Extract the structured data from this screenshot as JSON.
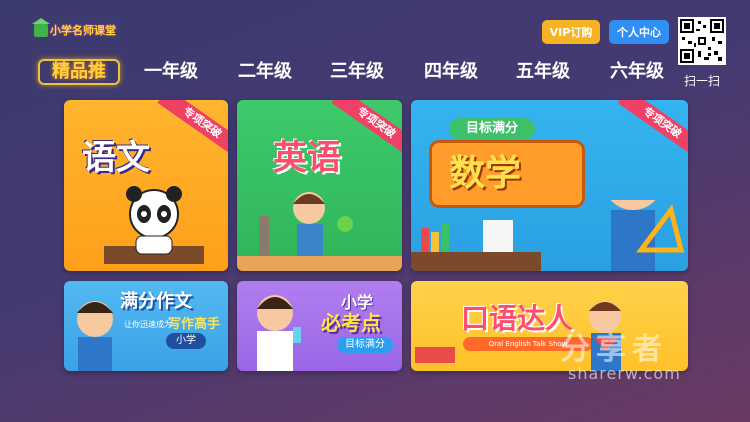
{
  "header": {
    "logo_text": "小学名师课堂",
    "vip_label": "VIP订购",
    "center_label": "个人中心",
    "scan_label": "扫一扫"
  },
  "tabs": [
    {
      "label": "精品推",
      "active": true
    },
    {
      "label": "一年级"
    },
    {
      "label": "二年级"
    },
    {
      "label": "三年级"
    },
    {
      "label": "四年级"
    },
    {
      "label": "五年级"
    },
    {
      "label": "六年级"
    }
  ],
  "cards": {
    "chinese": {
      "title": "语文",
      "badge": "专项突破"
    },
    "english": {
      "title": "英语",
      "badge": "专项突破"
    },
    "math": {
      "subtitle": "目标满分",
      "title": "数学",
      "badge": "专项突破"
    },
    "composition": {
      "title": "满分作文",
      "line1": "让你迅速成为",
      "line2": "写作高手",
      "tag": "小学"
    },
    "exam": {
      "title1": "小学",
      "title2": "必考点",
      "tag": "目标满分"
    },
    "oral": {
      "title": "口语达人",
      "subtitle": "Oral English Talk Show"
    }
  },
  "watermark": {
    "cn": "分享者",
    "en": "sharerw.com"
  },
  "colors": {
    "vip": "#f6b323",
    "center": "#2f8ff3",
    "ribbon": "#ef4066",
    "active_tab": "#ffd23f"
  }
}
